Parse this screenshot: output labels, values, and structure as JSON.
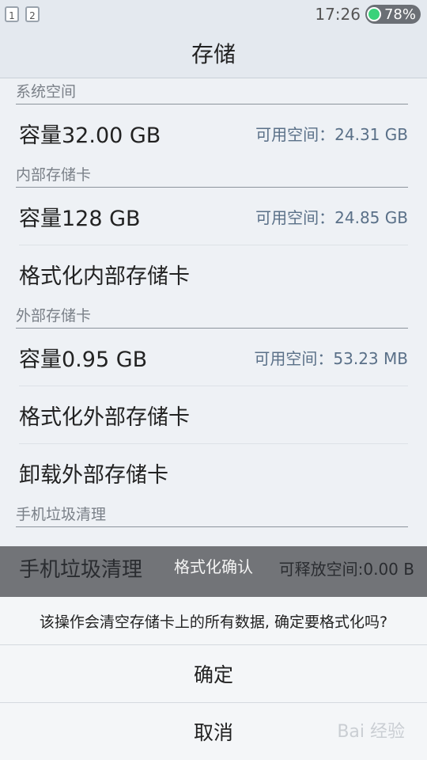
{
  "status_bar": {
    "notifications": [
      "1",
      "2"
    ],
    "time": "17:26",
    "battery": "78%"
  },
  "header": {
    "title": "存储"
  },
  "sections": [
    {
      "header": "系统空间",
      "rows": [
        {
          "label": "容量32.00 GB",
          "right": "可用空间：24.31 GB"
        }
      ]
    },
    {
      "header": "内部存储卡",
      "rows": [
        {
          "label": "容量128 GB",
          "right": "可用空间：24.85 GB"
        },
        {
          "label": "格式化内部存储卡",
          "right": ""
        }
      ]
    },
    {
      "header": "外部存储卡",
      "rows": [
        {
          "label": "容量0.95 GB",
          "right": "可用空间：53.23 MB"
        },
        {
          "label": "格式化外部存储卡",
          "right": ""
        },
        {
          "label": "卸载外部存储卡",
          "right": ""
        }
      ]
    },
    {
      "header": "手机垃圾清理",
      "rows": [
        {
          "label": "手机垃圾清理",
          "right": "可释放空间:0.00 B"
        }
      ]
    }
  ],
  "dialog": {
    "title": "格式化确认",
    "message": "该操作会清空存储卡上的所有数据, 确定要格式化吗?",
    "confirm_label": "确定",
    "cancel_label": "取消"
  },
  "watermark": "Bai 经验"
}
